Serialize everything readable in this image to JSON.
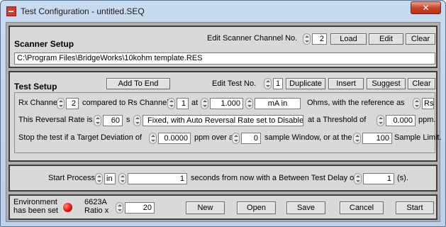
{
  "window": {
    "title": "Test Configuration - untitled.SEQ",
    "close_glyph": "✕"
  },
  "scanner": {
    "heading": "Scanner Setup",
    "edit_label": "Edit Scanner Channel No.",
    "channel_no": "2",
    "load": "Load",
    "edit": "Edit",
    "clear": "Clear",
    "file_path": "C:\\Program Files\\BridgeWorks\\10kohm template.RES"
  },
  "test": {
    "heading": "Test Setup",
    "add_to_end": "Add To End",
    "edit_label": "Edit Test No.",
    "test_no": "1",
    "duplicate": "Duplicate",
    "insert": "Insert",
    "suggest": "Suggest",
    "clear": "Clear",
    "row1": {
      "rx_label": "Rx Channel",
      "rx_value": "2",
      "compared_label": "compared to Rs Channel",
      "rs_value": "1",
      "at_label": "at",
      "current_value": "1.000",
      "current_unit": "mA in",
      "ohms_label": "Ohms, with the reference as",
      "reference_value": "Rs"
    },
    "row2": {
      "rate_label": "This Reversal Rate is",
      "rate_value": "60",
      "s_label": "s",
      "mode_value": "Fixed, with Auto Reversal Rate set to Disabled",
      "threshold_label": "at a Threshold of",
      "threshold_value": "0.000",
      "ppm_label": "ppm."
    },
    "row3": {
      "stop_label": "Stop the test if a Target Deviation of",
      "deviation_value": "0.0000",
      "over_label": "ppm over a",
      "window_value": "0",
      "window_label": "sample Window, or at the",
      "limit_value": "100",
      "limit_label": "Sample Limit."
    }
  },
  "process": {
    "start_label": "Start Process",
    "mode_value": "in",
    "seconds_value": "1",
    "middle_label": "seconds from now with a Between Test Delay of",
    "delay_value": "1",
    "unit_label": "(s)."
  },
  "footer": {
    "env_line1": "Environment",
    "env_line2": "has been set",
    "ratio_line1": "6623A",
    "ratio_line2": "Ratio x",
    "ratio_value": "20",
    "new": "New",
    "open": "Open",
    "save": "Save",
    "cancel": "Cancel",
    "start": "Start"
  },
  "colors": {
    "led": "#e0140a",
    "panel_bg": "#d9d9d9",
    "titlebar": "#c9dbee",
    "close": "#c7432b"
  }
}
